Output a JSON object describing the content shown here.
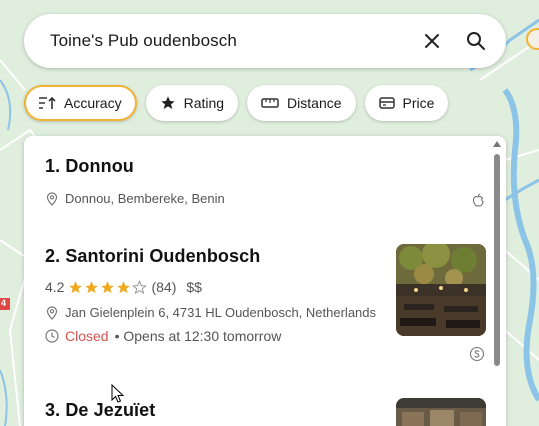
{
  "search": {
    "query": "Toine's Pub oudenbosch"
  },
  "filters": [
    {
      "label": "Accuracy",
      "icon": "sort-icon",
      "active": true
    },
    {
      "label": "Rating",
      "icon": "star-icon",
      "active": false
    },
    {
      "label": "Distance",
      "icon": "ruler-icon",
      "active": false
    },
    {
      "label": "Price",
      "icon": "wallet-icon",
      "active": false
    }
  ],
  "map": {
    "road_label": "4"
  },
  "results": [
    {
      "title": "1. Donnou",
      "address": "Donnou, Bembereke, Benin",
      "source_icon": "apple-icon"
    },
    {
      "title": "2. Santorini Oudenbosch",
      "rating": "4.2",
      "stars": 4.2,
      "review_count": "(84)",
      "price": "$$",
      "address": "Jan Gielenplein 6, 4731 HL Oudenbosch, Netherlands",
      "status_closed": "Closed",
      "status_detail": "• Opens at 12:30 tomorrow",
      "source_icon": "s-circle-icon"
    },
    {
      "title": "3. De Jezuïet"
    }
  ],
  "colors": {
    "accent": "#f2b233",
    "star": "#f0a81e",
    "closed": "#d9534f",
    "water": "#a9d4ee",
    "land": "#dfeedd"
  }
}
